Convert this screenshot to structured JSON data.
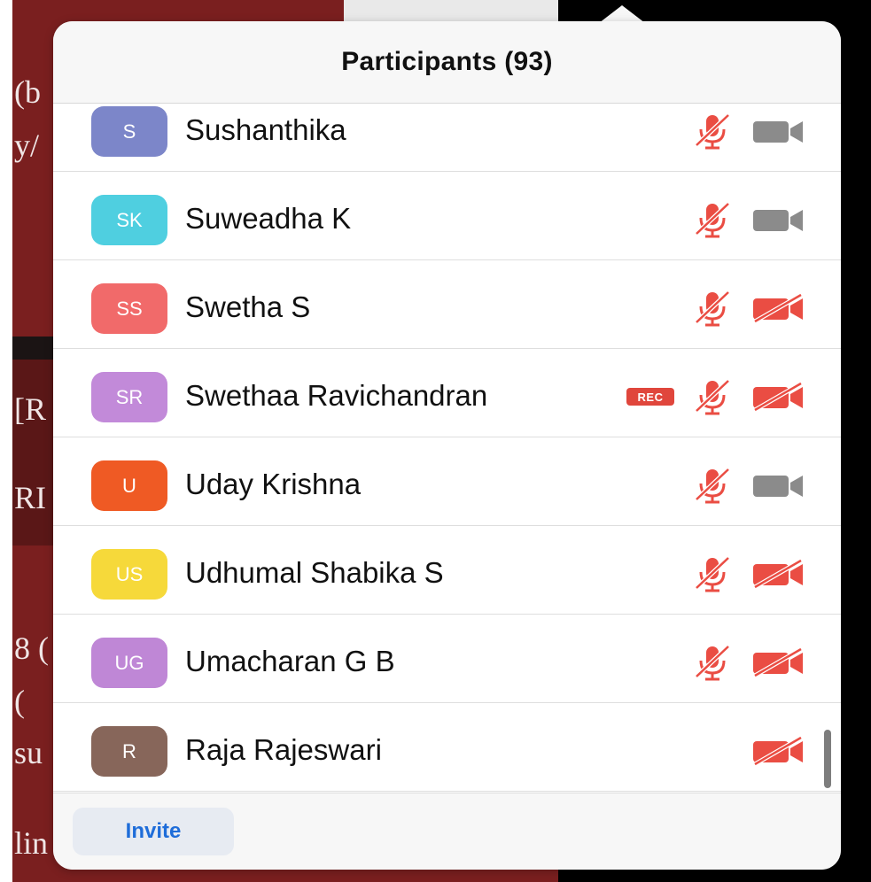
{
  "popover": {
    "title": "Participants (93)",
    "invite_label": "Invite"
  },
  "participants": [
    {
      "initials": "S",
      "name": "Sushanthika",
      "avatar_color": "#7c86c9",
      "rec": false,
      "mic": "muted",
      "camera": "on"
    },
    {
      "initials": "SK",
      "name": "Suweadha K",
      "avatar_color": "#4fcfe0",
      "rec": false,
      "mic": "muted",
      "camera": "on"
    },
    {
      "initials": "SS",
      "name": "Swetha S",
      "avatar_color": "#f16a6a",
      "rec": false,
      "mic": "muted",
      "camera": "off"
    },
    {
      "initials": "SR",
      "name": "Swethaa Ravichandran",
      "avatar_color": "#c28ad9",
      "rec": true,
      "rec_label": "REC",
      "mic": "muted",
      "camera": "off"
    },
    {
      "initials": "U",
      "name": "Uday Krishna",
      "avatar_color": "#ef5a24",
      "rec": false,
      "mic": "muted",
      "camera": "on"
    },
    {
      "initials": "US",
      "name": "Udhumal Shabika S",
      "avatar_color": "#f6d93a",
      "rec": false,
      "mic": "muted",
      "camera": "off"
    },
    {
      "initials": "UG",
      "name": "Umacharan G B",
      "avatar_color": "#bf87d6",
      "rec": false,
      "mic": "muted",
      "camera": "off"
    },
    {
      "initials": "R",
      "name": "Raja Rajeswari",
      "avatar_color": "#87665a",
      "rec": false,
      "mic": "none",
      "camera": "off"
    }
  ],
  "background_text": [
    {
      "text": "(b"
    },
    {
      "text": "y/"
    },
    {
      "text": "[R"
    },
    {
      "text": "RI"
    },
    {
      "text": "8 ("
    },
    {
      "text": "("
    },
    {
      "text": "su"
    },
    {
      "text": "lin"
    }
  ],
  "colors": {
    "muted_red": "#ea4d43",
    "camera_gray": "#8b8b8b",
    "link_blue": "#1f6dd9"
  },
  "icons": {
    "mic": "mic-muted-icon",
    "camera_on": "video-camera-icon",
    "camera_off": "video-camera-off-icon"
  }
}
